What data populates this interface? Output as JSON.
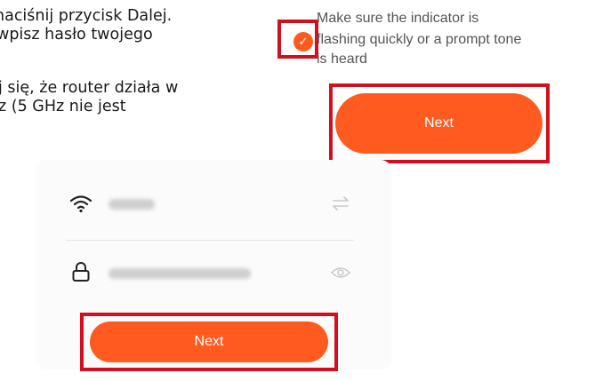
{
  "instructions": {
    "line1": "naciśnij przycisk Dalej.",
    "line2": "wpisz hasło twojego",
    "line3": "j się, że router działa w",
    "line4": "z (5 GHz nie jest"
  },
  "confirm": {
    "line1": "Make sure the indicator is",
    "line2": "flashing quickly or a prompt tone",
    "line3": "is heard",
    "checked": true,
    "check_glyph": "✓"
  },
  "buttons": {
    "next_top": "Next",
    "next_bottom": "Next"
  },
  "wifi_form": {
    "ssid_icon": "wifi-icon",
    "password_icon": "lock-icon",
    "switch_icon": "swap-arrows-icon",
    "visibility_icon": "eye-icon"
  },
  "colors": {
    "accent": "#ff5a1f",
    "highlight": "#d40f1d",
    "text": "#1a1a1a",
    "muted": "#555555",
    "card": "#fbfbfb"
  }
}
